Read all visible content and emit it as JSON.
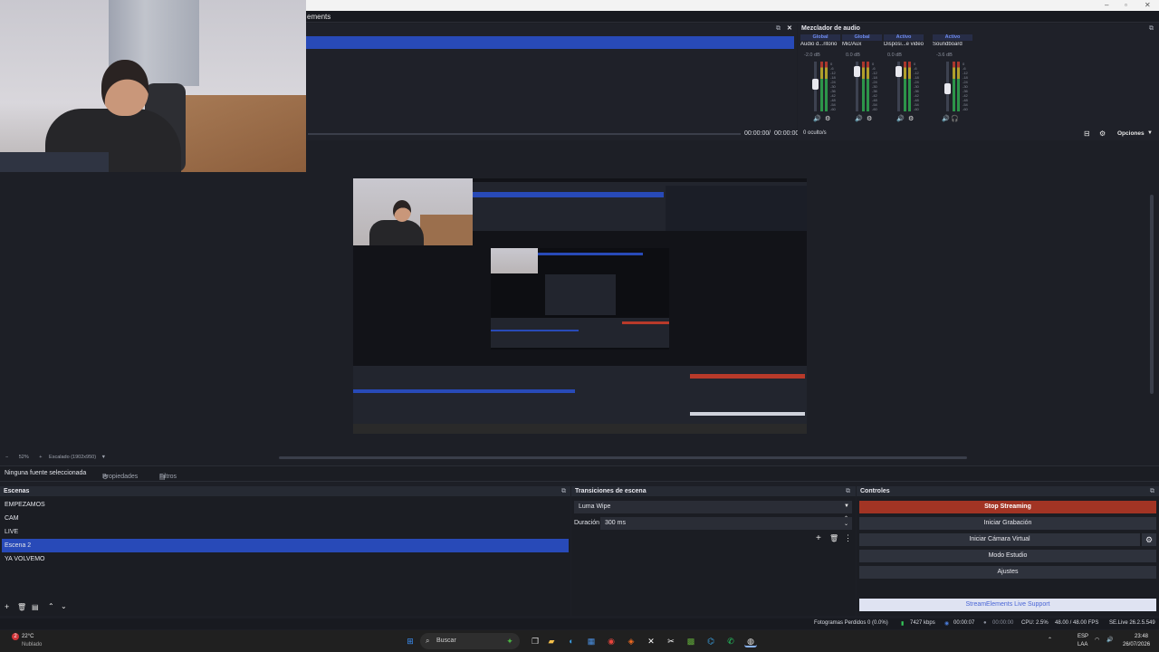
{
  "window": {
    "controls": [
      "–",
      "▫",
      "✕"
    ]
  },
  "menubar": {
    "visible_fragment": "ements"
  },
  "media_panel": {
    "time_current": "00:00:00",
    "time_sep": "/",
    "time_total": "00:00:00"
  },
  "mixer": {
    "title": "Mezclador de audio",
    "hidden_label": "0 oculto/s",
    "options_label": "Opciones",
    "channels": [
      {
        "tag": "Global",
        "name": "Audio d...ritorio",
        "db": "-2.0 dB",
        "level": 0.62
      },
      {
        "tag": "Global",
        "name": "Mic/Aux",
        "db": "0.0 dB",
        "level": 0.9
      },
      {
        "tag": "Activo",
        "name": "Disposi...e video",
        "db": "0.0 dB",
        "level": 0.9
      },
      {
        "tag": "Activo",
        "name": "Soundboard",
        "db": "-3.6 dB",
        "level": 0.52
      }
    ],
    "scale": [
      "0",
      "-6",
      "-12",
      "-18",
      "-24",
      "-30",
      "-36",
      "-42",
      "-48",
      "-54",
      "-60"
    ]
  },
  "preview": {
    "zoom_label": "52%",
    "resolution_label": "Escalado (1902x950)"
  },
  "source_bar": {
    "no_source": "Ninguna fuente seleccionada",
    "properties": "Propiedades",
    "filters": "Filtros"
  },
  "scenes": {
    "title": "Escenas",
    "items": [
      "EMPEZAMOS",
      "CAM",
      "LIVE",
      "Escena 2",
      "YA VOLVEMO"
    ],
    "selected_index": 3
  },
  "transitions": {
    "title": "Transiciones de escena",
    "selected": "Luma Wipe",
    "duration_label": "Duración",
    "duration_value": "300 ms"
  },
  "controls": {
    "title": "Controles",
    "stop_streaming": "Stop Streaming",
    "start_recording": "Iniciar Grabación",
    "virtual_cam": "Iniciar Cámara Virtual",
    "studio_mode": "Modo Estudio",
    "settings": "Ajustes",
    "support": "StreamElements Live Support"
  },
  "statusbar": {
    "frames_lost": "Fotogramas Perdidos 0 (0.0%)",
    "bitrate": "7427 kbps",
    "stream_time": "00:00:07",
    "rec_time": "00:00:00",
    "cpu": "CPU: 2.5%",
    "fps": "48.00 / 48.00 FPS",
    "version": "SE.Live 26.2.5.549"
  },
  "taskbar": {
    "weather_temp": "22°C",
    "weather_desc": "Nublado",
    "weather_badge": "2",
    "search_placeholder": "Buscar",
    "lang_top": "ESP",
    "lang_bottom": "LAA",
    "time": "23:48",
    "date": "26/07/2026"
  },
  "colors": {
    "accent_blue": "#284ab8",
    "stop_red": "#a23424",
    "meter_green": "#2fa84f",
    "meter_yellow": "#c9b52b",
    "meter_red": "#c33b2e"
  }
}
